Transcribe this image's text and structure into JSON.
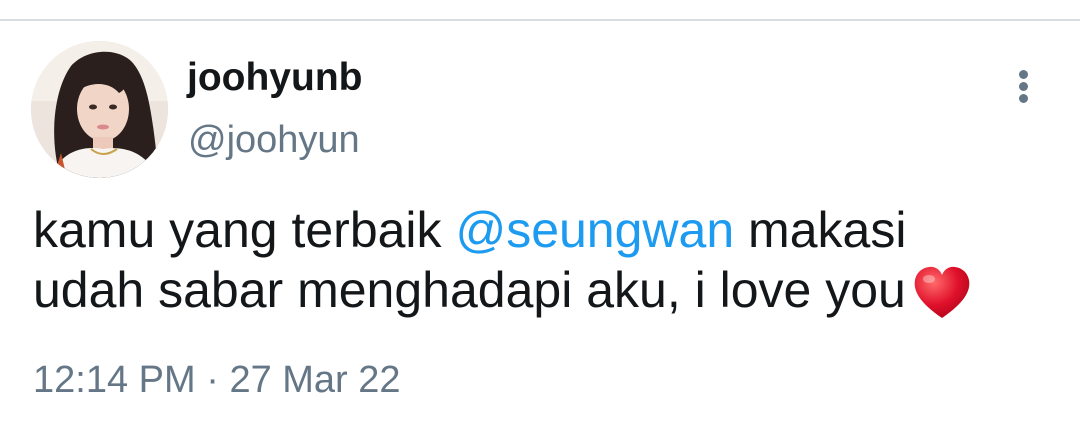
{
  "tweet": {
    "display_name": "joohyunb",
    "handle": "@joohyun",
    "text_line1_before": "kamu yang terbaik ",
    "mention": "@seungwan",
    "text_line1_after": " makasi",
    "text_line2": "udah sabar menghadapi aku, i love you",
    "emoji": "heart-icon",
    "time": "12:14 PM",
    "separator": " · ",
    "date": "27 Mar 22"
  },
  "icons": {
    "more": "more-vertical-icon",
    "heart": "red-heart-icon"
  },
  "colors": {
    "text": "#14171a",
    "secondary": "#657786",
    "mention": "#1d9bf0",
    "heart": "#e0102a"
  }
}
